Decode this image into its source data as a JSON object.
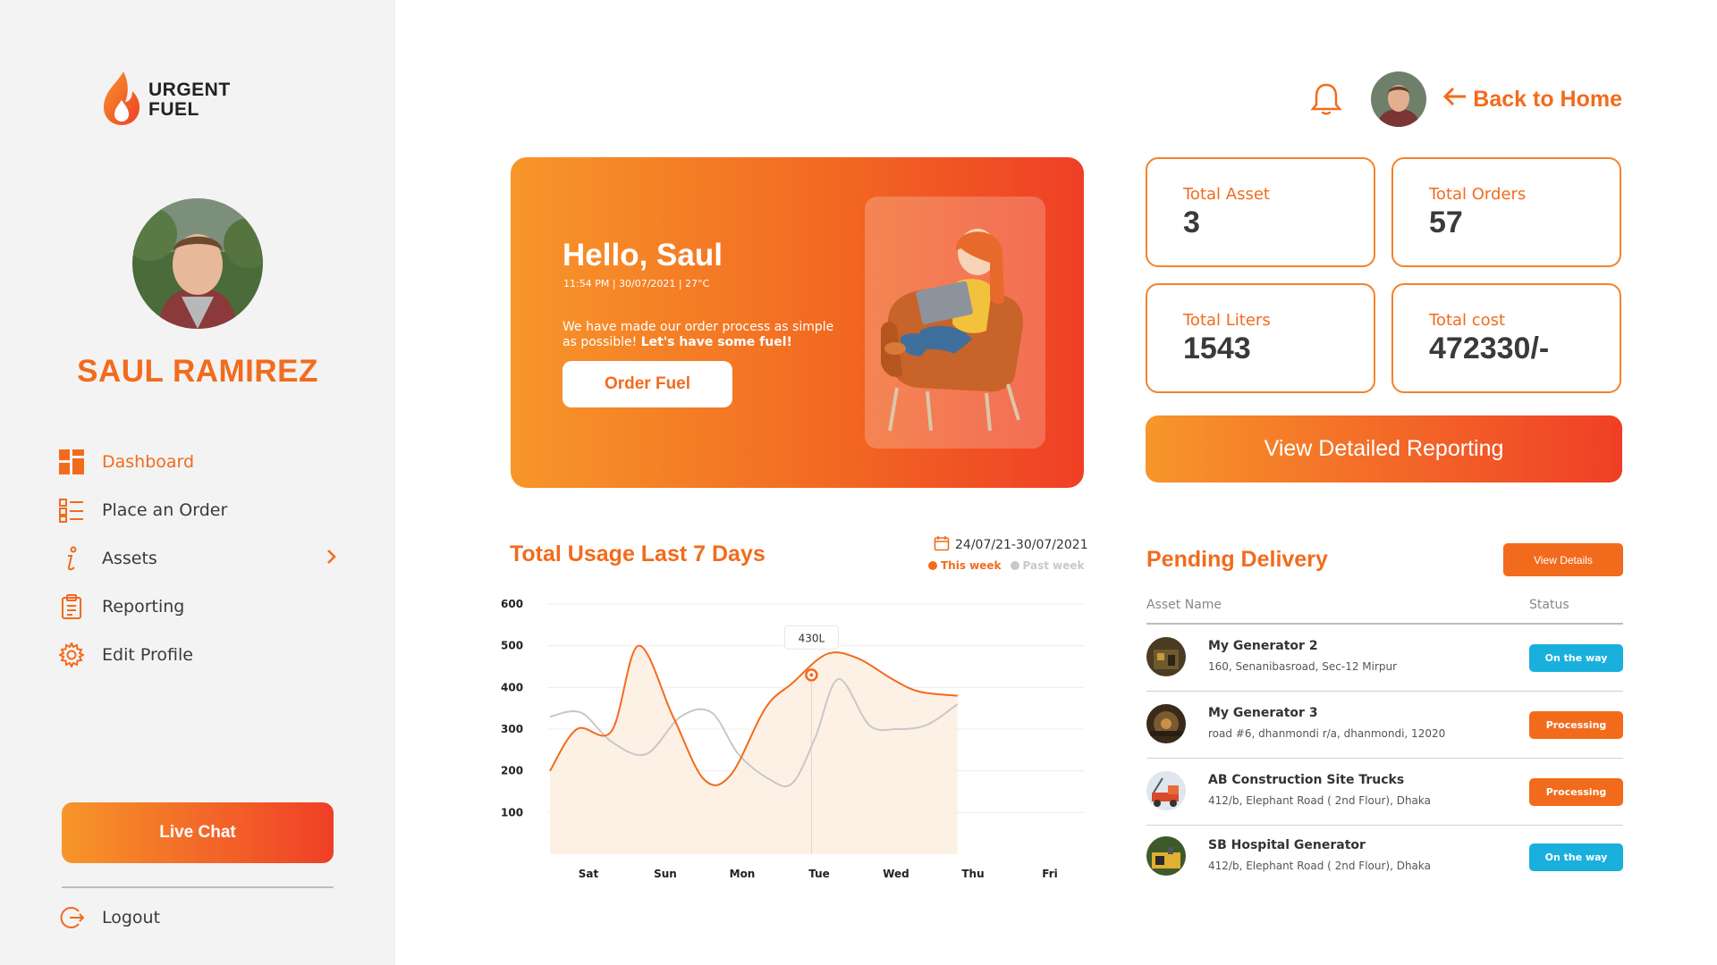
{
  "brand": {
    "name_line1": "URGENT",
    "name_line2": "FUEL",
    "accent": "#f26b1d",
    "gradient_start": "#f7962a",
    "gradient_end": "#ef3f26"
  },
  "sidebar": {
    "user_name": "SAUL RAMIREZ",
    "items": [
      {
        "label": "Dashboard",
        "icon": "dashboard-grid-icon",
        "active": true
      },
      {
        "label": "Place an Order",
        "icon": "checklist-icon"
      },
      {
        "label": "Assets",
        "icon": "info-icon",
        "has_chevron": true
      },
      {
        "label": "Reporting",
        "icon": "clipboard-icon"
      },
      {
        "label": "Edit Profile",
        "icon": "gear-icon"
      }
    ],
    "live_chat_label": "Live Chat",
    "logout_label": "Logout"
  },
  "header": {
    "back_home_label": "Back to Home"
  },
  "hero": {
    "greeting": "Hello, Saul",
    "meta": "11:54 PM | 30/07/2021 | 27°C",
    "message_plain": "We have made our order process as simple as possible!",
    "message_bold": "Let's have some fuel!",
    "order_button": "Order Fuel"
  },
  "stats": [
    {
      "label": "Total Asset",
      "value": "3"
    },
    {
      "label": "Total Orders",
      "value": "57"
    },
    {
      "label": "Total Liters",
      "value": "1543"
    },
    {
      "label": "Total cost",
      "value": "472330/-"
    }
  ],
  "view_report_label": "View Detailed Reporting",
  "chart": {
    "title": "Total Usage Last 7 Days",
    "date_range": "24/07/21-30/07/2021",
    "legend_this_week": "This week",
    "legend_past_week": "Past week",
    "tooltip": "430L"
  },
  "chart_data": {
    "type": "area",
    "categories": [
      "Sat",
      "Sun",
      "Mon",
      "Tue",
      "Wed",
      "Thu",
      "Fri"
    ],
    "ylim": [
      0,
      600
    ],
    "yticks": [
      100,
      200,
      300,
      400,
      500,
      600
    ],
    "grid": true,
    "legend_placement": "top-right",
    "series": [
      {
        "name": "This week",
        "color": "#f26b1d",
        "x": [
          0,
          0.35,
          0.8,
          1.15,
          1.6,
          2.0,
          2.35,
          2.8,
          3.15,
          3.6,
          4.0,
          4.45,
          4.8,
          5.3
        ],
        "y": [
          200,
          300,
          295,
          500,
          330,
          180,
          190,
          350,
          410,
          480,
          470,
          420,
          390,
          380
        ]
      },
      {
        "name": "Past week",
        "color": "#c8c8c8",
        "x": [
          0,
          0.4,
          0.8,
          1.25,
          1.7,
          2.1,
          2.45,
          2.85,
          3.15,
          3.45,
          3.75,
          4.15,
          4.5,
          4.9,
          5.3
        ],
        "y": [
          330,
          340,
          270,
          240,
          330,
          340,
          240,
          180,
          170,
          280,
          420,
          310,
          300,
          310,
          360
        ]
      }
    ],
    "highlight": {
      "x": 3.4,
      "y": 430,
      "label": "430L"
    }
  },
  "pending": {
    "title": "Pending Delivery",
    "view_details_label": "View Details",
    "col_asset": "Asset Name",
    "col_status": "Status",
    "rows": [
      {
        "name": "My Generator 2",
        "address": "160, Senanibasroad, Sec-12 Mirpur",
        "status": "On the way",
        "status_color": "#1ab0dd"
      },
      {
        "name": "My Generator 3",
        "address": "road #6, dhanmondi r/a, dhanmondi, 12020",
        "status": "Processing",
        "status_color": "#f26b1d"
      },
      {
        "name": "AB Construction Site Trucks",
        "address": "412/b, Elephant Road ( 2nd Flour), Dhaka",
        "status": "Processing",
        "status_color": "#f26b1d"
      },
      {
        "name": "SB Hospital Generator",
        "address": "412/b, Elephant Road ( 2nd Flour), Dhaka",
        "status": "On the way",
        "status_color": "#1ab0dd"
      }
    ]
  }
}
